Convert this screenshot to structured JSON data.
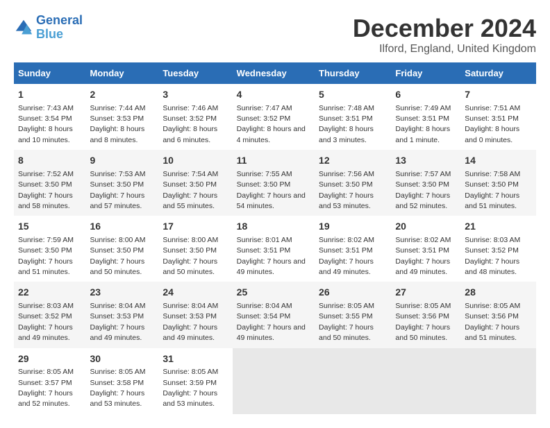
{
  "header": {
    "logo_line1": "General",
    "logo_line2": "Blue",
    "title": "December 2024",
    "subtitle": "Ilford, England, United Kingdom"
  },
  "columns": [
    "Sunday",
    "Monday",
    "Tuesday",
    "Wednesday",
    "Thursday",
    "Friday",
    "Saturday"
  ],
  "weeks": [
    [
      {
        "day": 1,
        "sunrise": "7:43 AM",
        "sunset": "3:54 PM",
        "daylight": "8 hours and 10 minutes."
      },
      {
        "day": 2,
        "sunrise": "7:44 AM",
        "sunset": "3:53 PM",
        "daylight": "8 hours and 8 minutes."
      },
      {
        "day": 3,
        "sunrise": "7:46 AM",
        "sunset": "3:52 PM",
        "daylight": "8 hours and 6 minutes."
      },
      {
        "day": 4,
        "sunrise": "7:47 AM",
        "sunset": "3:52 PM",
        "daylight": "8 hours and 4 minutes."
      },
      {
        "day": 5,
        "sunrise": "7:48 AM",
        "sunset": "3:51 PM",
        "daylight": "8 hours and 3 minutes."
      },
      {
        "day": 6,
        "sunrise": "7:49 AM",
        "sunset": "3:51 PM",
        "daylight": "8 hours and 1 minute."
      },
      {
        "day": 7,
        "sunrise": "7:51 AM",
        "sunset": "3:51 PM",
        "daylight": "8 hours and 0 minutes."
      }
    ],
    [
      {
        "day": 8,
        "sunrise": "7:52 AM",
        "sunset": "3:50 PM",
        "daylight": "7 hours and 58 minutes."
      },
      {
        "day": 9,
        "sunrise": "7:53 AM",
        "sunset": "3:50 PM",
        "daylight": "7 hours and 57 minutes."
      },
      {
        "day": 10,
        "sunrise": "7:54 AM",
        "sunset": "3:50 PM",
        "daylight": "7 hours and 55 minutes."
      },
      {
        "day": 11,
        "sunrise": "7:55 AM",
        "sunset": "3:50 PM",
        "daylight": "7 hours and 54 minutes."
      },
      {
        "day": 12,
        "sunrise": "7:56 AM",
        "sunset": "3:50 PM",
        "daylight": "7 hours and 53 minutes."
      },
      {
        "day": 13,
        "sunrise": "7:57 AM",
        "sunset": "3:50 PM",
        "daylight": "7 hours and 52 minutes."
      },
      {
        "day": 14,
        "sunrise": "7:58 AM",
        "sunset": "3:50 PM",
        "daylight": "7 hours and 51 minutes."
      }
    ],
    [
      {
        "day": 15,
        "sunrise": "7:59 AM",
        "sunset": "3:50 PM",
        "daylight": "7 hours and 51 minutes."
      },
      {
        "day": 16,
        "sunrise": "8:00 AM",
        "sunset": "3:50 PM",
        "daylight": "7 hours and 50 minutes."
      },
      {
        "day": 17,
        "sunrise": "8:00 AM",
        "sunset": "3:50 PM",
        "daylight": "7 hours and 50 minutes."
      },
      {
        "day": 18,
        "sunrise": "8:01 AM",
        "sunset": "3:51 PM",
        "daylight": "7 hours and 49 minutes."
      },
      {
        "day": 19,
        "sunrise": "8:02 AM",
        "sunset": "3:51 PM",
        "daylight": "7 hours and 49 minutes."
      },
      {
        "day": 20,
        "sunrise": "8:02 AM",
        "sunset": "3:51 PM",
        "daylight": "7 hours and 49 minutes."
      },
      {
        "day": 21,
        "sunrise": "8:03 AM",
        "sunset": "3:52 PM",
        "daylight": "7 hours and 48 minutes."
      }
    ],
    [
      {
        "day": 22,
        "sunrise": "8:03 AM",
        "sunset": "3:52 PM",
        "daylight": "7 hours and 49 minutes."
      },
      {
        "day": 23,
        "sunrise": "8:04 AM",
        "sunset": "3:53 PM",
        "daylight": "7 hours and 49 minutes."
      },
      {
        "day": 24,
        "sunrise": "8:04 AM",
        "sunset": "3:53 PM",
        "daylight": "7 hours and 49 minutes."
      },
      {
        "day": 25,
        "sunrise": "8:04 AM",
        "sunset": "3:54 PM",
        "daylight": "7 hours and 49 minutes."
      },
      {
        "day": 26,
        "sunrise": "8:05 AM",
        "sunset": "3:55 PM",
        "daylight": "7 hours and 50 minutes."
      },
      {
        "day": 27,
        "sunrise": "8:05 AM",
        "sunset": "3:56 PM",
        "daylight": "7 hours and 50 minutes."
      },
      {
        "day": 28,
        "sunrise": "8:05 AM",
        "sunset": "3:56 PM",
        "daylight": "7 hours and 51 minutes."
      }
    ],
    [
      {
        "day": 29,
        "sunrise": "8:05 AM",
        "sunset": "3:57 PM",
        "daylight": "7 hours and 52 minutes."
      },
      {
        "day": 30,
        "sunrise": "8:05 AM",
        "sunset": "3:58 PM",
        "daylight": "7 hours and 53 minutes."
      },
      {
        "day": 31,
        "sunrise": "8:05 AM",
        "sunset": "3:59 PM",
        "daylight": "7 hours and 53 minutes."
      },
      null,
      null,
      null,
      null
    ]
  ]
}
